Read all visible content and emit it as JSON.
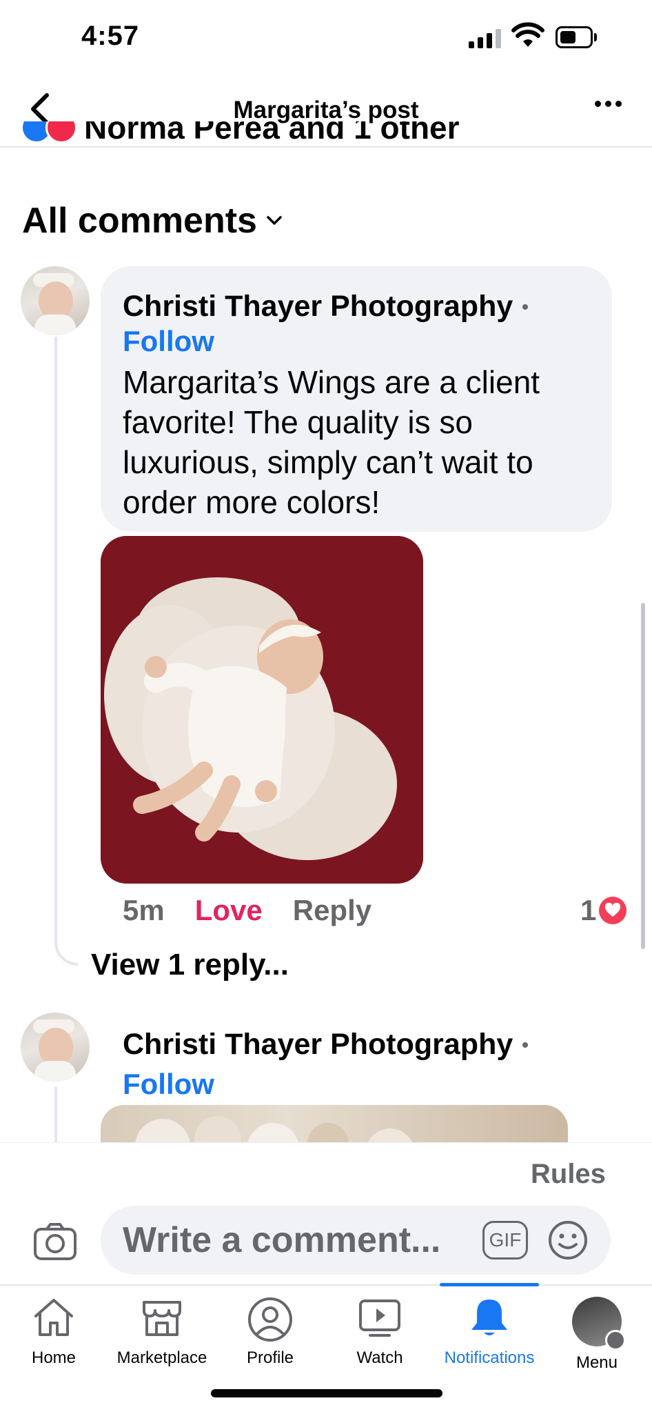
{
  "status_bar": {
    "time": "4:57"
  },
  "header": {
    "title": "Margarita’s post"
  },
  "reactions": {
    "text": "Norma Perea and 1 other"
  },
  "comments_header": {
    "label": "All comments"
  },
  "comments": [
    {
      "author": "Christi Thayer Photography",
      "follow": "Follow",
      "text": "Margarita’s Wings are a client favorite!  The quality is so luxurious, simply can’t wait to order more colors!",
      "time": "5m",
      "love_label": "Love",
      "reply_label": "Reply",
      "reaction_count": "1",
      "view_replies": "View 1 reply..."
    },
    {
      "author": "Christi Thayer Photography",
      "follow": "Follow"
    }
  ],
  "composer": {
    "rules": "Rules",
    "placeholder": "Write a comment...",
    "gif_label": "GIF"
  },
  "tabs": [
    {
      "label": "Home",
      "icon": "home-icon"
    },
    {
      "label": "Marketplace",
      "icon": "marketplace-icon"
    },
    {
      "label": "Profile",
      "icon": "profile-icon"
    },
    {
      "label": "Watch",
      "icon": "watch-icon"
    },
    {
      "label": "Notifications",
      "icon": "bell-icon",
      "active": true
    },
    {
      "label": "Menu",
      "icon": "menu-avatar"
    }
  ],
  "colors": {
    "accent": "#1877f2",
    "love": "#e0245e",
    "bubble": "#f0f2f5",
    "photo_background": "#7b1520"
  }
}
